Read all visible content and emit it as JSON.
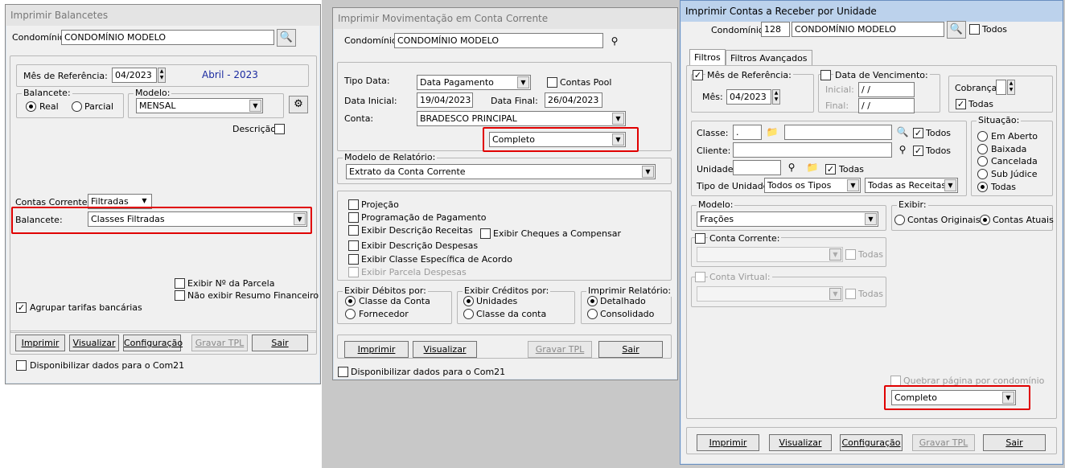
{
  "w1": {
    "title": "Imprimir Balancetes",
    "condominio_label": "Condomínio:",
    "condominio_value": "CONDOMÍNIO MODELO",
    "mes_label": "Mês de Referência:",
    "mes_value": "04/2023",
    "mes_display": "Abril - 2023",
    "balancete_group": "Balancete:",
    "radio_real": "Real",
    "radio_parcial": "Parcial",
    "modelo_group": "Modelo:",
    "modelo_value": "MENSAL",
    "descricao_label": "Descrição",
    "contas_label": "Contas Correntes:",
    "contas_value": "Filtradas",
    "balancete_label": "Balancete:",
    "balancete_value": "Classes Filtradas",
    "exibir_parcela": "Exibir Nº da Parcela",
    "nao_exibir_resumo": "Não exibir Resumo Financeiro",
    "agrupar_tarifas": "Agrupar tarifas bancárias",
    "btn_imprimir": "Imprimir",
    "btn_visualizar": "Visualizar",
    "btn_config": "Configuração",
    "btn_gravar": "Gravar TPL",
    "btn_sair": "Sair",
    "disponibilizar": "Disponibilizar dados para o Com21"
  },
  "w2": {
    "title": "Imprimir Movimentação em Conta Corrente",
    "condominio_label": "Condomínio:",
    "condominio_value": "CONDOMÍNIO MODELO",
    "tipo_data_label": "Tipo Data:",
    "tipo_data_value": "Data Pagamento",
    "contas_pool": "Contas Pool",
    "data_inicial_label": "Data Inicial:",
    "data_inicial_value": "19/04/2023",
    "data_final_label": "Data Final:",
    "data_final_value": "26/04/2023",
    "conta_label": "Conta:",
    "conta_value": "BRADESCO PRINCIPAL",
    "completo_value": "Completo",
    "modelo_group": "Modelo de Relatório:",
    "modelo_value": "Extrato da Conta Corrente",
    "opt_projecao": "Projeção",
    "opt_programacao": "Programação de Pagamento",
    "opt_desc_receitas": "Exibir Descrição Receitas",
    "opt_desc_despesas": "Exibir Descrição Despesas",
    "opt_classe_acordo": "Exibir Classe Específica de Acordo",
    "opt_parcela_despesas": "Exibir Parcela Despesas",
    "opt_cheques": "Exibir Cheques a Compensar",
    "debitos_group": "Exibir Débitos por:",
    "deb_classe": "Classe da Conta",
    "deb_fornecedor": "Fornecedor",
    "creditos_group": "Exibir Créditos por:",
    "cred_unidades": "Unidades",
    "cred_classe": "Classe da conta",
    "imprimir_group": "Imprimir Relatório:",
    "imp_detalhado": "Detalhado",
    "imp_consolidado": "Consolidado",
    "btn_imprimir": "Imprimir",
    "btn_visualizar": "Visualizar",
    "btn_gravar": "Gravar TPL",
    "btn_sair": "Sair",
    "disponibilizar": "Disponibilizar dados para o Com21"
  },
  "w3": {
    "title": "Imprimir Contas a Receber por Unidade",
    "condominio_label": "Condomínio:",
    "condominio_code": "128",
    "condominio_value": "CONDOMÍNIO MODELO",
    "todos": "Todos",
    "tab_filtros": "Filtros",
    "tab_avancados": "Filtros Avançados",
    "mes_group": "Mês de Referência:",
    "mes_label": "Mês:",
    "mes_value": "04/2023",
    "venc_group": "Data de Vencimento:",
    "inicial_label": "Inicial:",
    "inicial_value": " / /",
    "final_label": "Final:",
    "final_value": " / /",
    "cobranca_label": "Cobrança:",
    "cobranca_todas": "Todas",
    "classe_label": "Classe:",
    "classe_value": ".",
    "classe_todos": "Todos",
    "cliente_label": "Cliente:",
    "cliente_todos": "Todos",
    "unidade_label": "Unidade:",
    "unidade_todas": "Todas",
    "tipo_unidade_label": "Tipo de Unidade:",
    "tipo_unidade_value": "Todos os Tipos",
    "receitas_value": "Todas as Receitas",
    "situacao_group": "Situação:",
    "sit_aberto": "Em Aberto",
    "sit_baixada": "Baixada",
    "sit_cancelada": "Cancelada",
    "sit_subjudice": "Sub Júdice",
    "sit_todas": "Todas",
    "modelo_group": "Modelo:",
    "modelo_value": "Frações",
    "exibir_group": "Exibir:",
    "exibir_originais": "Contas Originais",
    "exibir_atuais": "Contas Atuais",
    "conta_corrente_group": "Conta Corrente:",
    "cc_todas": "Todas",
    "conta_virtual_group": "Conta Virtual:",
    "cv_todas": "Todas",
    "quebrar_pagina": "Quebrar página por condomínio",
    "completo_value": "Completo",
    "btn_imprimir": "Imprimir",
    "btn_visualizar": "Visualizar",
    "btn_config": "Configuração",
    "btn_gravar": "Gravar TPL",
    "btn_sair": "Sair"
  }
}
